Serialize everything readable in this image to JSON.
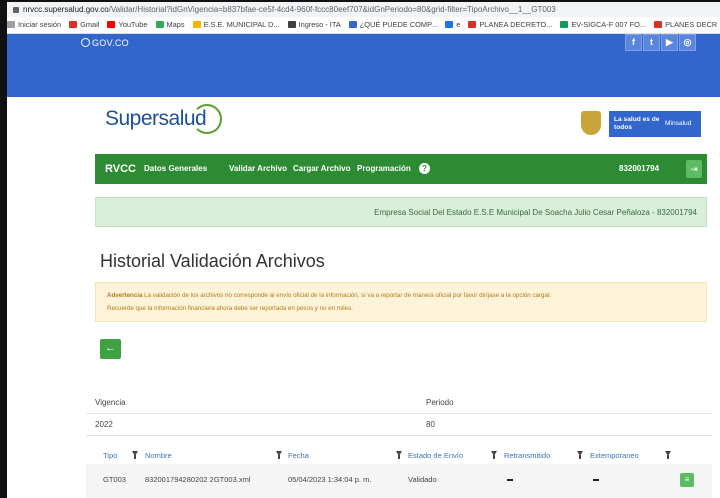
{
  "browser": {
    "url_host": "nrvcc.supersalud.gov.co",
    "url_path": "/Validar/Historial?idGnVigencia=b837bfae-ce5f-4cd4-960f-fccc80eef707&idGnPeriodo=80&grid-filter=TipoArchivo__1__GT003",
    "bookmarks": [
      {
        "label": "Iniciar sesión",
        "icon": "link-icon",
        "color": "#9aa0a6"
      },
      {
        "label": "Gmail",
        "icon": "gmail-icon",
        "color": "#d93025"
      },
      {
        "label": "YouTube",
        "icon": "youtube-icon",
        "color": "#ff0000"
      },
      {
        "label": "Maps",
        "icon": "maps-icon",
        "color": "#34a853"
      },
      {
        "label": "E.S.E. MUNICIPAL D...",
        "icon": "site-icon",
        "color": "#f4b400"
      },
      {
        "label": "Ingreso - ITA",
        "icon": "site-icon",
        "color": "#3c4043"
      },
      {
        "label": "¿QUÉ PUEDE COMP...",
        "icon": "site-icon",
        "color": "#3366cc"
      },
      {
        "label": "e",
        "icon": "site-icon",
        "color": "#1a73e8"
      },
      {
        "label": "PLANEA DECRETO...",
        "icon": "gmail-icon",
        "color": "#d93025"
      },
      {
        "label": "EV-SIGCA-F 007 FO...",
        "icon": "sheet-icon",
        "color": "#0f9d58"
      },
      {
        "label": "PLANES DECR",
        "icon": "gmail-icon",
        "color": "#d93025"
      }
    ]
  },
  "gov": {
    "logo": "GOV.CO",
    "social_icons": [
      "f",
      "t",
      "▶",
      "◎"
    ]
  },
  "brand": {
    "name": "Supersalud",
    "ministry_slogan": "La salud es de todos",
    "ministry": "Minsalud"
  },
  "nav": {
    "brand": "RVCC",
    "items": [
      "Datos Generales",
      "Validar Archivo",
      "Cargar Archivo",
      "Programación"
    ],
    "help": "?",
    "nit": "832001794",
    "logout_icon": "logout-icon"
  },
  "entity": "Empresa Social Del Estado E.S.E Municipal De Soacha Julio Cesar Peñaloza - 832001794",
  "page_title": "Historial Validación Archivos",
  "alert": {
    "label": "Advertencia",
    "line1": " La validación de los archivos no corresponde al envío oficial de la información, si va a reportar de manera oficial por favor diríjase a la opción cargar.",
    "line2": "Recuerde que la información financiera ahora debe ser reportada en pesos y no en miles."
  },
  "back_button": "←",
  "meta": {
    "vigencia_label": "Vigencia",
    "vigencia_value": "2022",
    "periodo_label": "Periodo",
    "periodo_value": "80"
  },
  "table": {
    "headers": [
      "Tipo",
      "Nombre",
      "Fecha",
      "Estado de Envío",
      "Retransmitido",
      "Extemporaneo"
    ],
    "rows": [
      {
        "tipo": "GT003",
        "nombre": "832001794280202 2GT003.xml",
        "fecha": "05/04/2023 1:34:04 p. m.",
        "estado": "Validado",
        "retransmitido": "–",
        "extemporaneo": "–"
      }
    ]
  },
  "colors": {
    "gov_blue": "#3366cc",
    "nav_green": "#2d8c33",
    "alert_bg": "#fcf3d8",
    "entity_bg": "#d8efd9"
  }
}
